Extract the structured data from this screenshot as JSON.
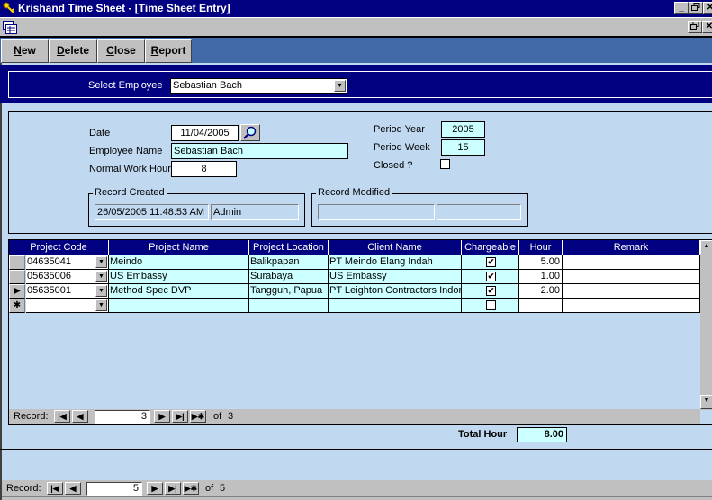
{
  "window": {
    "title": "Krishand Time Sheet - [Time Sheet Entry]",
    "app_icon": "key-icon",
    "controls": {
      "minimize": "_",
      "restore": "🗗",
      "close": "✕"
    }
  },
  "menubar": {
    "doc_icon": "form-icon"
  },
  "toolbar": {
    "buttons": [
      {
        "label": "New",
        "accel": "N"
      },
      {
        "label": "Delete",
        "accel": "D"
      },
      {
        "label": "Close",
        "accel": "C"
      },
      {
        "label": "Report",
        "accel": "R"
      }
    ]
  },
  "employee_select": {
    "label": "Select Employee",
    "value": "Sebastian Bach"
  },
  "header": {
    "date_label": "Date",
    "date_value": "11/04/2005",
    "employee_name_label": "Employee Name",
    "employee_name_value": "Sebastian Bach",
    "normal_work_hour_label": "Normal Work Hour",
    "normal_work_hour_value": "8",
    "period_year_label": "Period Year",
    "period_year_value": "2005",
    "period_week_label": "Period Week",
    "period_week_value": "15",
    "closed_label": "Closed ?",
    "closed_checked": false,
    "record_created": {
      "label": "Record Created",
      "datetime": "26/05/2005 11:48:53 AM",
      "user": "Admin"
    },
    "record_modified": {
      "label": "Record Modified",
      "datetime": "",
      "user": ""
    }
  },
  "grid": {
    "columns": [
      "Project Code",
      "Project Name",
      "Project Location",
      "Client Name",
      "Chargeable",
      "Hour",
      "Remark"
    ],
    "rows": [
      {
        "selector": "",
        "project_code": "04635041",
        "project_name": "Meindo",
        "project_location": "Balikpapan",
        "client_name": "PT Meindo Elang Indah",
        "chargeable": true,
        "hour": "5.00",
        "remark": ""
      },
      {
        "selector": "",
        "project_code": "05635006",
        "project_name": "US Embassy",
        "project_location": "Surabaya",
        "client_name": "US Embassy",
        "chargeable": true,
        "hour": "1.00",
        "remark": ""
      },
      {
        "selector": "▶",
        "project_code": "05635001",
        "project_name": "Method Spec DVP",
        "project_location": "Tangguh, Papua",
        "client_name": "PT Leighton Contractors Indon",
        "chargeable": true,
        "hour": "2.00",
        "remark": ""
      },
      {
        "selector": "✱",
        "project_code": "",
        "project_name": "",
        "project_location": "",
        "client_name": "",
        "chargeable": false,
        "hour": "",
        "remark": ""
      }
    ],
    "nav": {
      "label": "Record:",
      "current": "3",
      "of_label": "of",
      "total": "3"
    }
  },
  "totals": {
    "label": "Total Hour",
    "value": "8.00"
  },
  "main_nav": {
    "label": "Record:",
    "current": "5",
    "of_label": "of",
    "total": "5"
  },
  "colors": {
    "titlebar": "#000080",
    "toolbar_bg": "#4169a8",
    "form_bg": "#c0d8f0",
    "readonly_field": "#ccffff",
    "grid_header": "#000080"
  }
}
